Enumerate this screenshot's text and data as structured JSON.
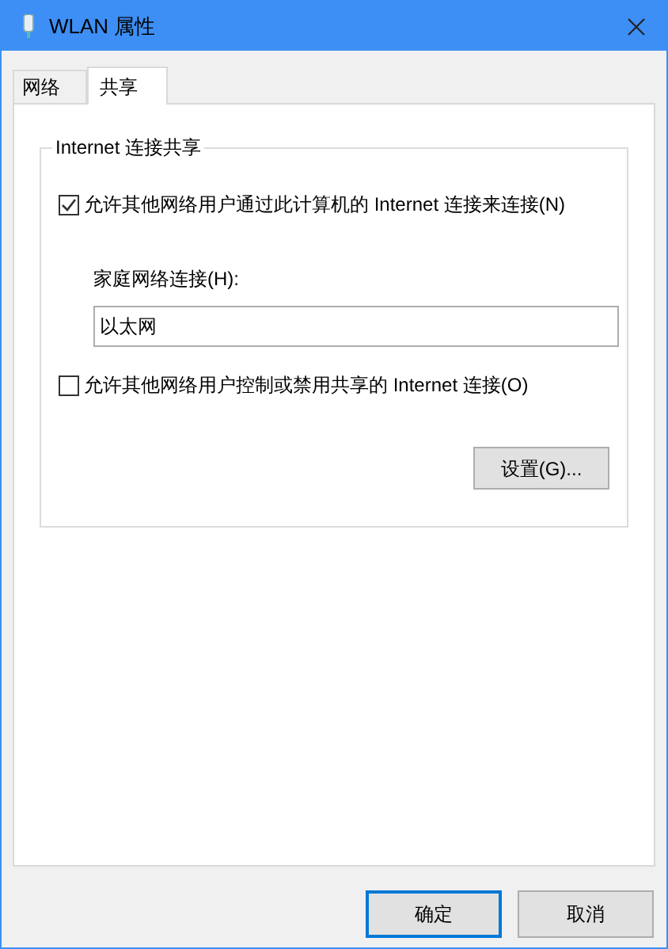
{
  "window": {
    "title": "WLAN 属性"
  },
  "tabs": [
    {
      "label": "网络",
      "selected": false
    },
    {
      "label": "共享",
      "selected": true
    }
  ],
  "group": {
    "title": "Internet 连接共享",
    "allow_sharing": {
      "label": "允许其他网络用户通过此计算机的 Internet 连接来连接(N)",
      "checked": true
    },
    "home_connection": {
      "label": "家庭网络连接(H):",
      "value": "以太网"
    },
    "allow_control": {
      "label": "允许其他网络用户控制或禁用共享的 Internet 连接(O)",
      "checked": false
    },
    "settings_button": "设置(G)..."
  },
  "buttons": [
    {
      "label": "确定",
      "default": true
    },
    {
      "label": "取消",
      "default": false
    }
  ]
}
